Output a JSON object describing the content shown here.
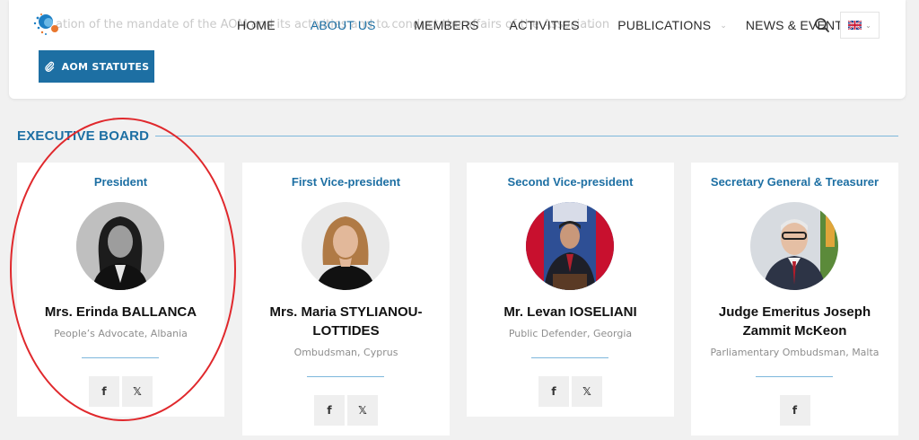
{
  "page": {
    "faded_text": "ation of the mandate of the AOM and its activities and to conduct the affairs of the Association",
    "statutes_button": "AOM STATUTES"
  },
  "nav": {
    "items": [
      {
        "label": "HOME",
        "dropdown": false,
        "active": false
      },
      {
        "label": "ABOUT US",
        "dropdown": true,
        "active": true
      },
      {
        "label": "MEMBERS",
        "dropdown": false,
        "active": false
      },
      {
        "label": "ACTIVITIES",
        "dropdown": true,
        "active": false
      },
      {
        "label": "PUBLICATIONS",
        "dropdown": true,
        "active": false
      },
      {
        "label": "NEWS & EVENTS",
        "dropdown": false,
        "active": false
      }
    ],
    "search_icon": "search-icon",
    "language_icon": "uk-flag-icon"
  },
  "section": {
    "title": "EXECUTIVE BOARD"
  },
  "board": [
    {
      "role": "President",
      "name": "Mrs. Erinda BALLANCA",
      "description": "People’s Advocate, Albania",
      "socials": [
        "f",
        "𝕏"
      ]
    },
    {
      "role": "First Vice-president",
      "name": "Mrs. Maria STYLIANOU-LOTTIDES",
      "description": "Ombudsman, Cyprus",
      "socials": [
        "f",
        "𝕏"
      ]
    },
    {
      "role": "Second Vice-president",
      "name": "Mr. Levan IOSELIANI",
      "description": "Public Defender, Georgia",
      "socials": [
        "f",
        "𝕏"
      ]
    },
    {
      "role": "Secretary General & Treasurer",
      "name": "Judge Emeritus Joseph Zammit McKeon",
      "description": "Parliamentary Ombudsman, Malta",
      "socials": [
        "f"
      ]
    }
  ],
  "colors": {
    "accent": "#1d6fa3",
    "annotation": "#e0282c"
  }
}
